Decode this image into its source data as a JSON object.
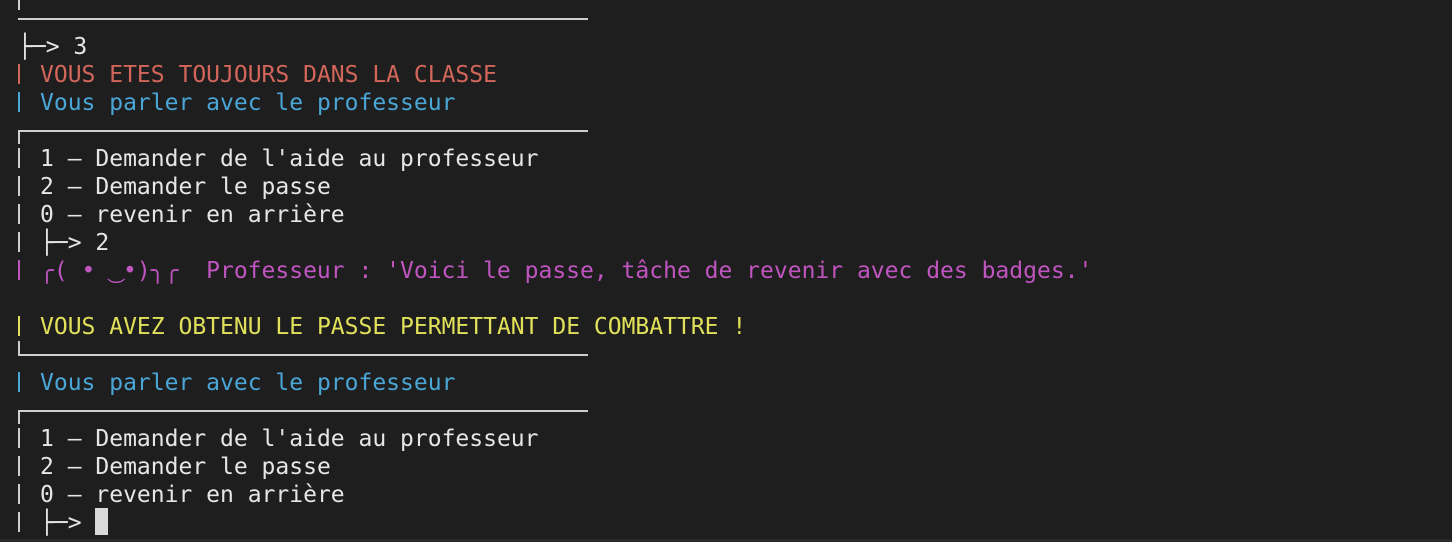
{
  "prompt_arrow": "├─>",
  "top_partial": "",
  "entries": {
    "answer1": "3",
    "status_class": "VOUS ETES TOUJOURS DANS LA CLASSE",
    "talk1": "Vous parler avec le professeur",
    "menu1": [
      "1 – Demander de l'aide au professeur",
      "2 – Demander le passe",
      "0 – revenir en arrière"
    ],
    "answer2": "2",
    "lenny": "╭( • ͜ •)╮╭",
    "prof_line": "Professeur : 'Voici le passe, tâche de revenir avec des badges.'",
    "obtained": "VOUS AVEZ OBTENU LE PASSE PERMETTANT DE COMBATTRE !",
    "talk2": "Vous parler avec le professeur",
    "menu2": [
      "1 – Demander de l'aide au professeur",
      "2 – Demander le passe",
      "0 – revenir en arrière"
    ]
  },
  "colors": {
    "background": "#1e1e1e",
    "red": "#d2665a",
    "blue": "#4aa6d6",
    "magenta": "#c055c0",
    "yellow": "#e0e05a",
    "text": "#e6e6e6"
  }
}
